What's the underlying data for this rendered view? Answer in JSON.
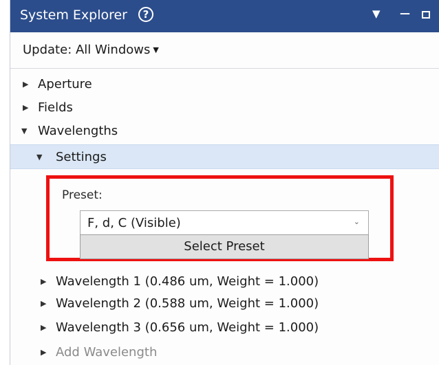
{
  "window": {
    "title": "System Explorer"
  },
  "icons": {
    "help": "help-circle-icon",
    "dropdown": "dropdown-triangle-icon",
    "minimize": "minimize-icon",
    "maximize": "maximize-icon"
  },
  "update": {
    "label": "Update: All Windows"
  },
  "tree": {
    "aperture": "Aperture",
    "fields": "Fields",
    "wavelengths": "Wavelengths",
    "settings": "Settings",
    "preset_label": "Preset:",
    "preset_value": "F, d, C (Visible)",
    "select_preset": "Select Preset",
    "wavelength_items": [
      "Wavelength 1 (0.486 um, Weight = 1.000)",
      "Wavelength 2 (0.588 um, Weight = 1.000)",
      "Wavelength 3 (0.656 um, Weight = 1.000)"
    ],
    "add_wavelength": "Add Wavelength"
  },
  "colors": {
    "titlebar": "#2c4d8c",
    "selection": "#dbe7f6",
    "highlight_frame": "#ee1111"
  }
}
